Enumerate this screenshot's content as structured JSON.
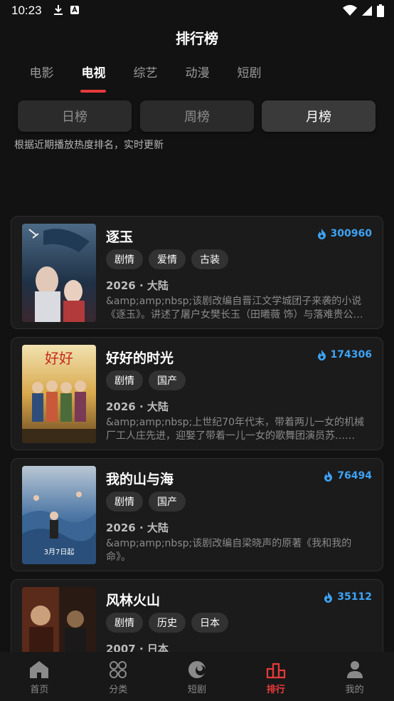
{
  "status": {
    "time": "10:23"
  },
  "header": {
    "title": "排行榜"
  },
  "tabs": [
    {
      "label": "电影"
    },
    {
      "label": "电视"
    },
    {
      "label": "综艺"
    },
    {
      "label": "动漫"
    },
    {
      "label": "短剧"
    }
  ],
  "ranking_periods": [
    {
      "label": "日榜"
    },
    {
      "label": "周榜"
    },
    {
      "label": "月榜"
    }
  ],
  "subtitle": "根据近期播放热度排名，实时更新",
  "items": [
    {
      "title": "逐玉",
      "heat": "300960",
      "tags": [
        "剧情",
        "爱情",
        "古装"
      ],
      "meta": "2026 · 大陆",
      "description": "&amp;amp;nbsp;该剧改编自晋江文学城团子来袭的小说《逐玉》。讲述了屠户女樊长玉（田曦薇 饰）与落难贵公子……"
    },
    {
      "title": "好好的时光",
      "heat": "174306",
      "tags": [
        "剧情",
        "国产"
      ],
      "meta": "2026 · 大陆",
      "description": "&amp;amp;nbsp;上世纪70年代末，带着两儿一女的机械厂工人庄先进，迎娶了带着一儿一女的歌舞团演员苏……"
    },
    {
      "title": "我的山与海",
      "heat": "76494",
      "tags": [
        "剧情",
        "国产"
      ],
      "meta": "2026 · 大陆",
      "description": "&amp;amp;nbsp;该剧改编自梁晓声的原著《我和我的命》。"
    },
    {
      "title": "风林火山",
      "heat": "35112",
      "tags": [
        "剧情",
        "历史",
        "日本"
      ],
      "meta": "2007 · 日本",
      "description": ""
    }
  ],
  "bottom_nav": [
    {
      "label": "首页",
      "icon": "home-icon"
    },
    {
      "label": "分类",
      "icon": "category-icon"
    },
    {
      "label": "短剧",
      "icon": "short-drama-icon"
    },
    {
      "label": "排行",
      "icon": "ranking-icon"
    },
    {
      "label": "我的",
      "icon": "profile-icon"
    }
  ],
  "colors": {
    "accent": "#e83a3a",
    "heat": "#3da3f5",
    "background": "#121212"
  }
}
